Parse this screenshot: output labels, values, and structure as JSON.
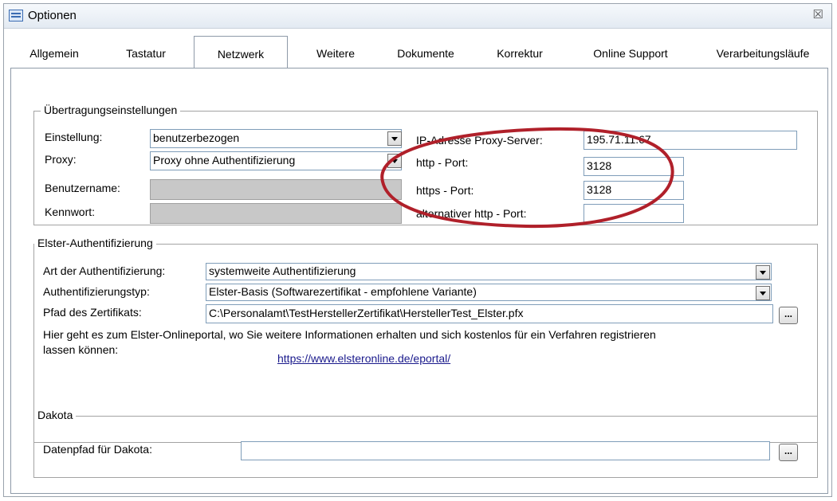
{
  "window": {
    "title": "Optionen",
    "close_symbol": "☒"
  },
  "tabs": [
    {
      "label": "Allgemein"
    },
    {
      "label": "Tastatur"
    },
    {
      "label": "Netzwerk"
    },
    {
      "label": "Weitere"
    },
    {
      "label": "Dokumente"
    },
    {
      "label": "Korrektur"
    },
    {
      "label": "Online Support"
    },
    {
      "label": "Verarbeitungsläufe"
    }
  ],
  "active_tab": "Netzwerk",
  "transfer": {
    "legend": "Übertragungseinstellungen",
    "setting_label": "Einstellung:",
    "setting_value": "benutzerbezogen",
    "proxy_label": "Proxy:",
    "proxy_value": "Proxy ohne Authentifizierung",
    "username_label": "Benutzername:",
    "password_label": "Kennwort:",
    "ip_label": "IP-Adresse Proxy-Server:",
    "ip_value": "195.71.11.67",
    "http_port_label": "http - Port:",
    "http_port_value": "3128",
    "https_port_label": "https - Port:",
    "https_port_value": "3128",
    "alt_port_label": "alternativer http - Port:",
    "alt_port_value": ""
  },
  "elster": {
    "legend": "Elster-Authentifizierung",
    "auth_kind_label": "Art der Authentifizierung:",
    "auth_kind_value": "systemweite Authentifizierung",
    "auth_type_label": "Authentifizierungstyp:",
    "auth_type_value": "Elster-Basis (Softwarezertifikat - empfohlene Variante)",
    "cert_path_label": "Pfad des Zertifikats:",
    "cert_path_value": "C:\\Personalamt\\TestHerstellerZertifikat\\HerstellerTest_Elster.pfx",
    "browse_label": "...",
    "info_text_1": "Hier geht es zum Elster-Onlineportal, wo Sie weitere Informationen erhalten und sich kostenlos für ein Verfahren registrieren",
    "info_text_2": "lassen können:",
    "link": "https://www.elsteronline.de/eportal/"
  },
  "dakota": {
    "legend": "Dakota",
    "path_label": "Datenpfad für Dakota:",
    "path_value": "",
    "browse_label": "..."
  },
  "annotation_color": "#b0202a"
}
